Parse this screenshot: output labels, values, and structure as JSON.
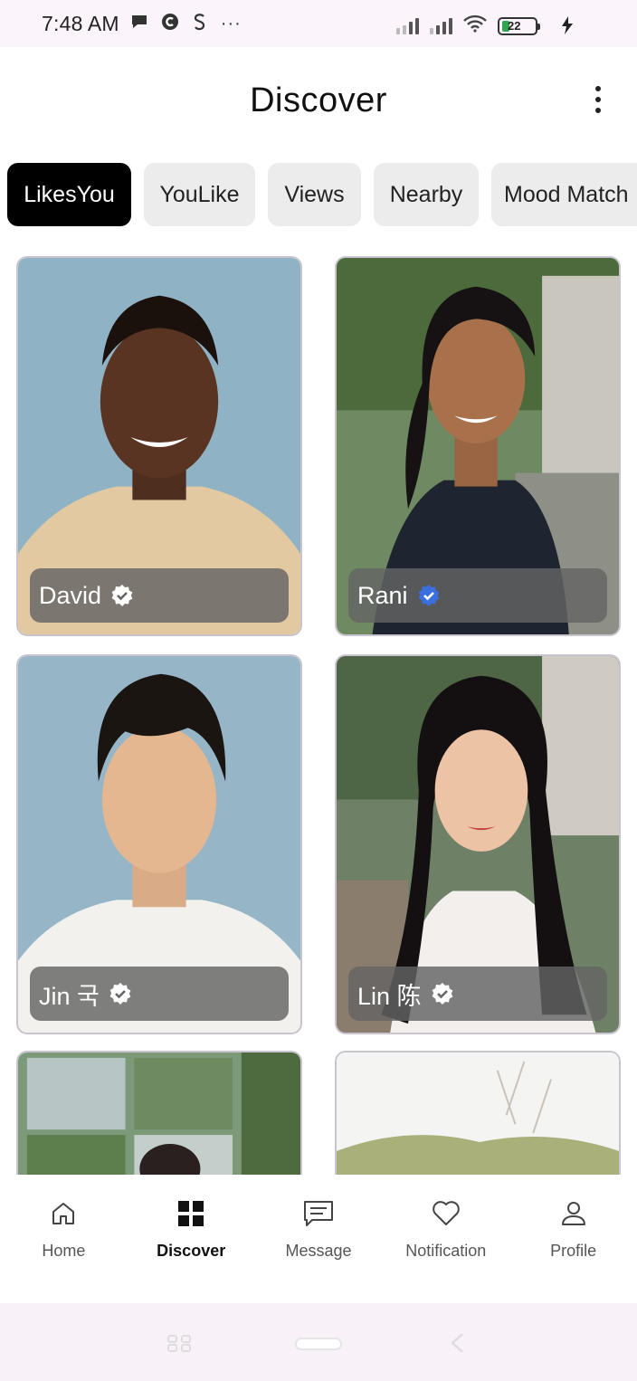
{
  "status_bar": {
    "time": "7:48 AM",
    "more": "···",
    "battery_level": "22",
    "icons": [
      "chat-bubble-icon",
      "app-c-icon",
      "app-s-icon",
      "signal-icon",
      "signal-icon",
      "wifi-icon",
      "battery-icon",
      "charging-icon"
    ]
  },
  "header": {
    "title": "Discover",
    "menu_icon": "more-vertical-icon"
  },
  "tabs": [
    {
      "label": "LikesYou",
      "active": true
    },
    {
      "label": "YouLike",
      "active": false
    },
    {
      "label": "Views",
      "active": false
    },
    {
      "label": "Nearby",
      "active": false
    },
    {
      "label": "Mood Match",
      "active": false
    }
  ],
  "profiles": [
    {
      "name": "David",
      "verified": true,
      "badge_color": "#ffffff"
    },
    {
      "name": "Rani",
      "verified": true,
      "badge_color": "#3b6fe0"
    },
    {
      "name": "Jin 국",
      "verified": true,
      "badge_color": "#ffffff"
    },
    {
      "name": "Lin 陈",
      "verified": true,
      "badge_color": "#ffffff"
    }
  ],
  "bottom_nav": [
    {
      "label": "Home",
      "icon": "home-icon",
      "active": false
    },
    {
      "label": "Discover",
      "icon": "grid-icon",
      "active": true
    },
    {
      "label": "Message",
      "icon": "message-icon",
      "active": false
    },
    {
      "label": "Notification",
      "icon": "heart-icon",
      "active": false
    },
    {
      "label": "Profile",
      "icon": "person-icon",
      "active": false
    }
  ],
  "colors": {
    "active_tab_bg": "#000000",
    "inactive_tab_bg": "#ececec",
    "verified_blue": "#3b6fe0"
  }
}
